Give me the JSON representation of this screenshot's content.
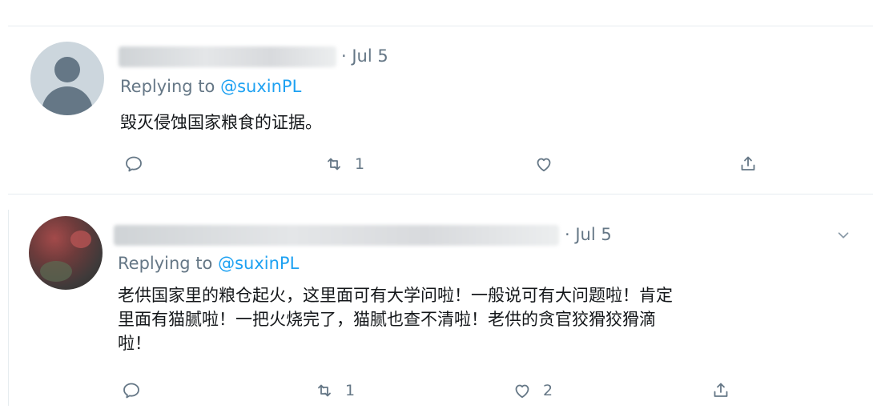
{
  "tweets": [
    {
      "date": "· Jul 5",
      "replying_prefix": "Replying to",
      "replying_handle": "@suxinPL",
      "text": "毁灭侵蚀国家粮食的证据。",
      "actions": {
        "reply_count": "",
        "retweet_count": "1",
        "like_count": ""
      }
    },
    {
      "date": "· Jul 5",
      "replying_prefix": "Replying to",
      "replying_handle": "@suxinPL",
      "text_lines": [
        "老供国家里的粮仓起火，这里面可有大学问啦！一般说可有大问题啦！肯定",
        "里面有猫腻啦！一把火烧完了，猫腻也查不清啦！老供的贪官狡猾狡猾滴",
        "啦！"
      ],
      "actions": {
        "reply_count": "",
        "retweet_count": "1",
        "like_count": "2"
      }
    }
  ],
  "icons": {
    "reply": "reply-icon",
    "retweet": "retweet-icon",
    "like": "heart-icon",
    "share": "share-icon",
    "more": "chevron-down-icon"
  },
  "colors": {
    "accent": "#1da1f2",
    "muted": "#657786",
    "text": "#14171a"
  }
}
